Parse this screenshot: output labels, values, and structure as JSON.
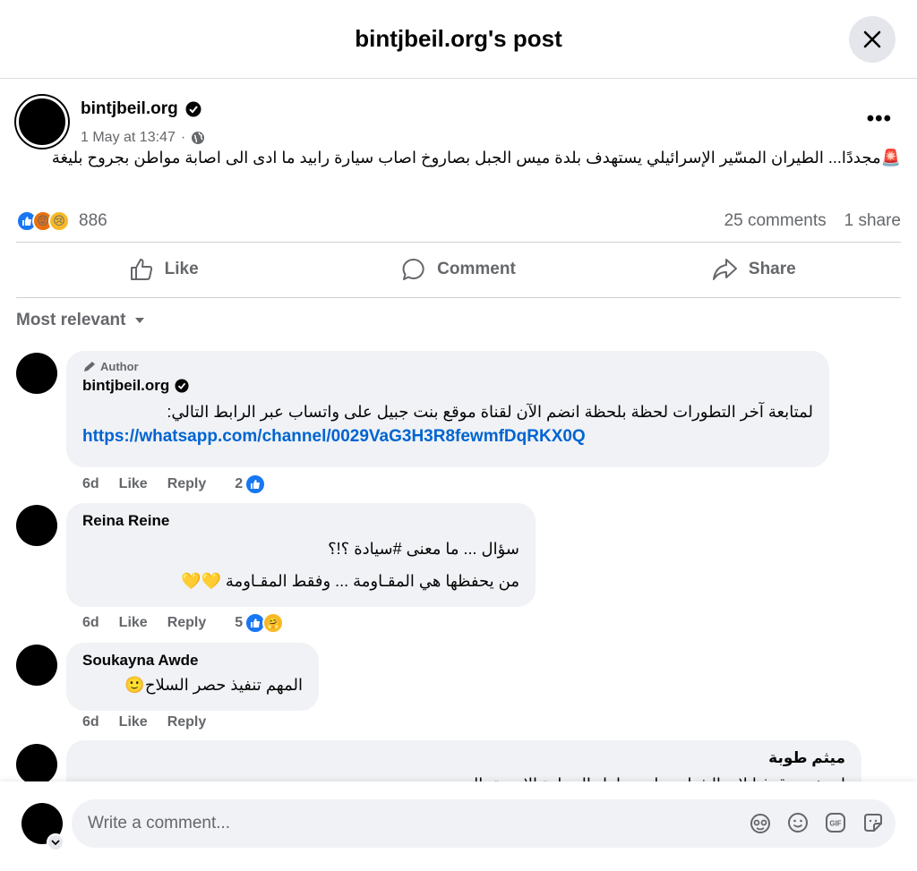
{
  "modal": {
    "title": "bintjbeil.org's post"
  },
  "post": {
    "author": "bintjbeil.org",
    "timestamp": "1 May at 13:47",
    "text": "🚨مجددًا... الطيران المسّير الإسرائيلي يستهدف بلدة ميس الجبل بصاروخ اصاب سيارة رابيد ما ادى الى اصابة مواطن بجروح بليغة",
    "reactions_count": "886",
    "comments_count": "25 comments",
    "shares_count": "1 share"
  },
  "actions": {
    "like": "Like",
    "comment": "Comment",
    "share": "Share"
  },
  "sort": {
    "label": "Most relevant"
  },
  "comments": [
    {
      "tag": "Author",
      "name": "bintjbeil.org",
      "text": "لمتابعة آخر التطورات لحظة بلحظة انضم الآن لقناة موقع بنت جبيل على واتساب عبر الرابط التالي:",
      "link": "https://whatsapp.com/channel/0029VaG3H3R8fewmfDqRKX0Q",
      "age": "6d",
      "like": "Like",
      "reply": "Reply",
      "count": "2"
    },
    {
      "name": "Reina Reine",
      "line1": "سؤال ... ما معنى #سيادة ؟!؟",
      "line2": "من يحفظها هي المقـاومة ... وفقط المقـاومة 💛💛",
      "age": "6d",
      "like": "Like",
      "reply": "Reply",
      "count": "5"
    },
    {
      "name": "Soukayna Awde",
      "text": "المهم تنفيذ حصر السلاح🙂",
      "age": "6d",
      "like": "Like",
      "reply": "Reply"
    },
    {
      "name": "ميثم طوبة",
      "text": "استغرب قرفيا لانه الشباب ما بتستاهل السيادة الاهمية بالمعنى"
    }
  ],
  "composer": {
    "placeholder": "Write a comment..."
  },
  "colors": {
    "accent": "#1877f2",
    "link": "#0064d1",
    "bubble": "#f0f2f5",
    "muted": "#65676b"
  }
}
